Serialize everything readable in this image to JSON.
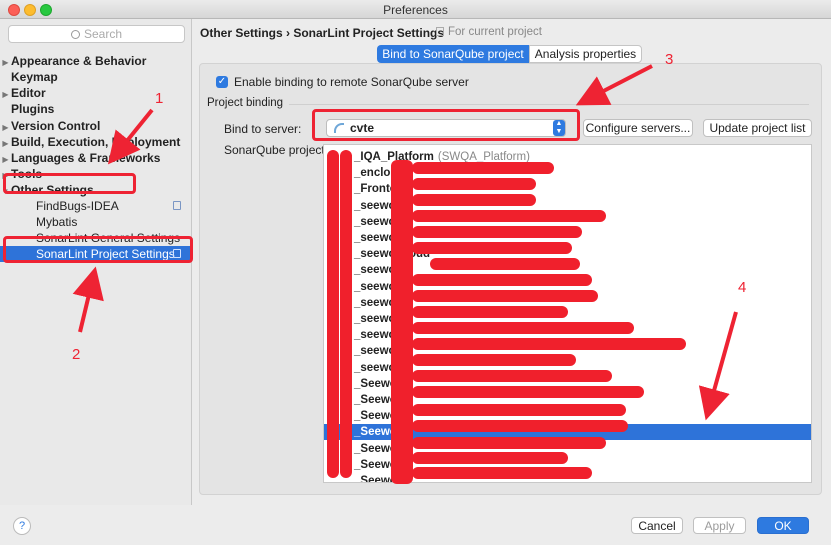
{
  "window": {
    "title": "Preferences"
  },
  "sidebar": {
    "search_placeholder": "Search",
    "items": [
      {
        "label": "Appearance & Behavior",
        "arrow": "▶"
      },
      {
        "label": "Keymap",
        "arrow": ""
      },
      {
        "label": "Editor",
        "arrow": "▶"
      },
      {
        "label": "Plugins",
        "arrow": ""
      },
      {
        "label": "Version Control",
        "arrow": "▶"
      },
      {
        "label": "Build, Execution, Deployment",
        "arrow": "▶"
      },
      {
        "label": "Languages & Frameworks",
        "arrow": "▶"
      },
      {
        "label": "Tools",
        "arrow": "▶"
      },
      {
        "label": "Other Settings",
        "arrow": "▼"
      },
      {
        "label": "FindBugs-IDEA",
        "arrow": ""
      },
      {
        "label": "Mybatis",
        "arrow": ""
      },
      {
        "label": "SonarLint General Settings",
        "arrow": ""
      },
      {
        "label": "SonarLint Project Settings",
        "arrow": ""
      }
    ]
  },
  "header": {
    "breadcrumb": "Other Settings › SonarLint Project Settings",
    "note": "For current project",
    "tabs": [
      "Bind to SonarQube project",
      "Analysis properties"
    ]
  },
  "binding": {
    "enable_label": "Enable binding to remote SonarQube server",
    "group_label": "Project binding",
    "server_label": "Bind to server:",
    "server_value": "cvte",
    "configure_button": "Configure servers...",
    "update_button": "Update project list",
    "project_label": "SonarQube project:"
  },
  "projects": [
    {
      "name": "_IQA_Platform",
      "key": "(SWQA_Platform)"
    },
    {
      "name": "_enclou",
      "key": ""
    },
    {
      "name": "_Fronte",
      "key": ""
    },
    {
      "name": "_seewo-",
      "key": ""
    },
    {
      "name": "_seewo-",
      "key": ""
    },
    {
      "name": "_seewo-",
      "key": ""
    },
    {
      "name": "_seewo-cloud",
      "key": ""
    },
    {
      "name": "_seewo-n-",
      "key": ""
    },
    {
      "name": "_seewo-",
      "key": ""
    },
    {
      "name": "_seewo-",
      "key": ""
    },
    {
      "name": "_seewo-",
      "key": ""
    },
    {
      "name": "_seewo-",
      "key": ""
    },
    {
      "name": "_seewo-",
      "key": ""
    },
    {
      "name": "_seewo-",
      "key": ""
    },
    {
      "name": "_Seewo",
      "key": ""
    },
    {
      "name": "_Seewo",
      "key": ""
    },
    {
      "name": "_Seewo",
      "key": ""
    },
    {
      "name": "_Seewo",
      "key": ""
    },
    {
      "name": "_Seewo",
      "key": ""
    },
    {
      "name": "_Seewo",
      "key": ""
    },
    {
      "name": "_SeewoS",
      "key": ""
    }
  ],
  "selected_project_index": 17,
  "annotations": [
    "1",
    "2",
    "3",
    "4"
  ],
  "footer": {
    "help": "?",
    "cancel": "Cancel",
    "apply": "Apply",
    "ok": "OK"
  },
  "colors": {
    "accent": "#2e7ae0",
    "annotation": "#ee2333",
    "selection": "#2e73d9"
  }
}
